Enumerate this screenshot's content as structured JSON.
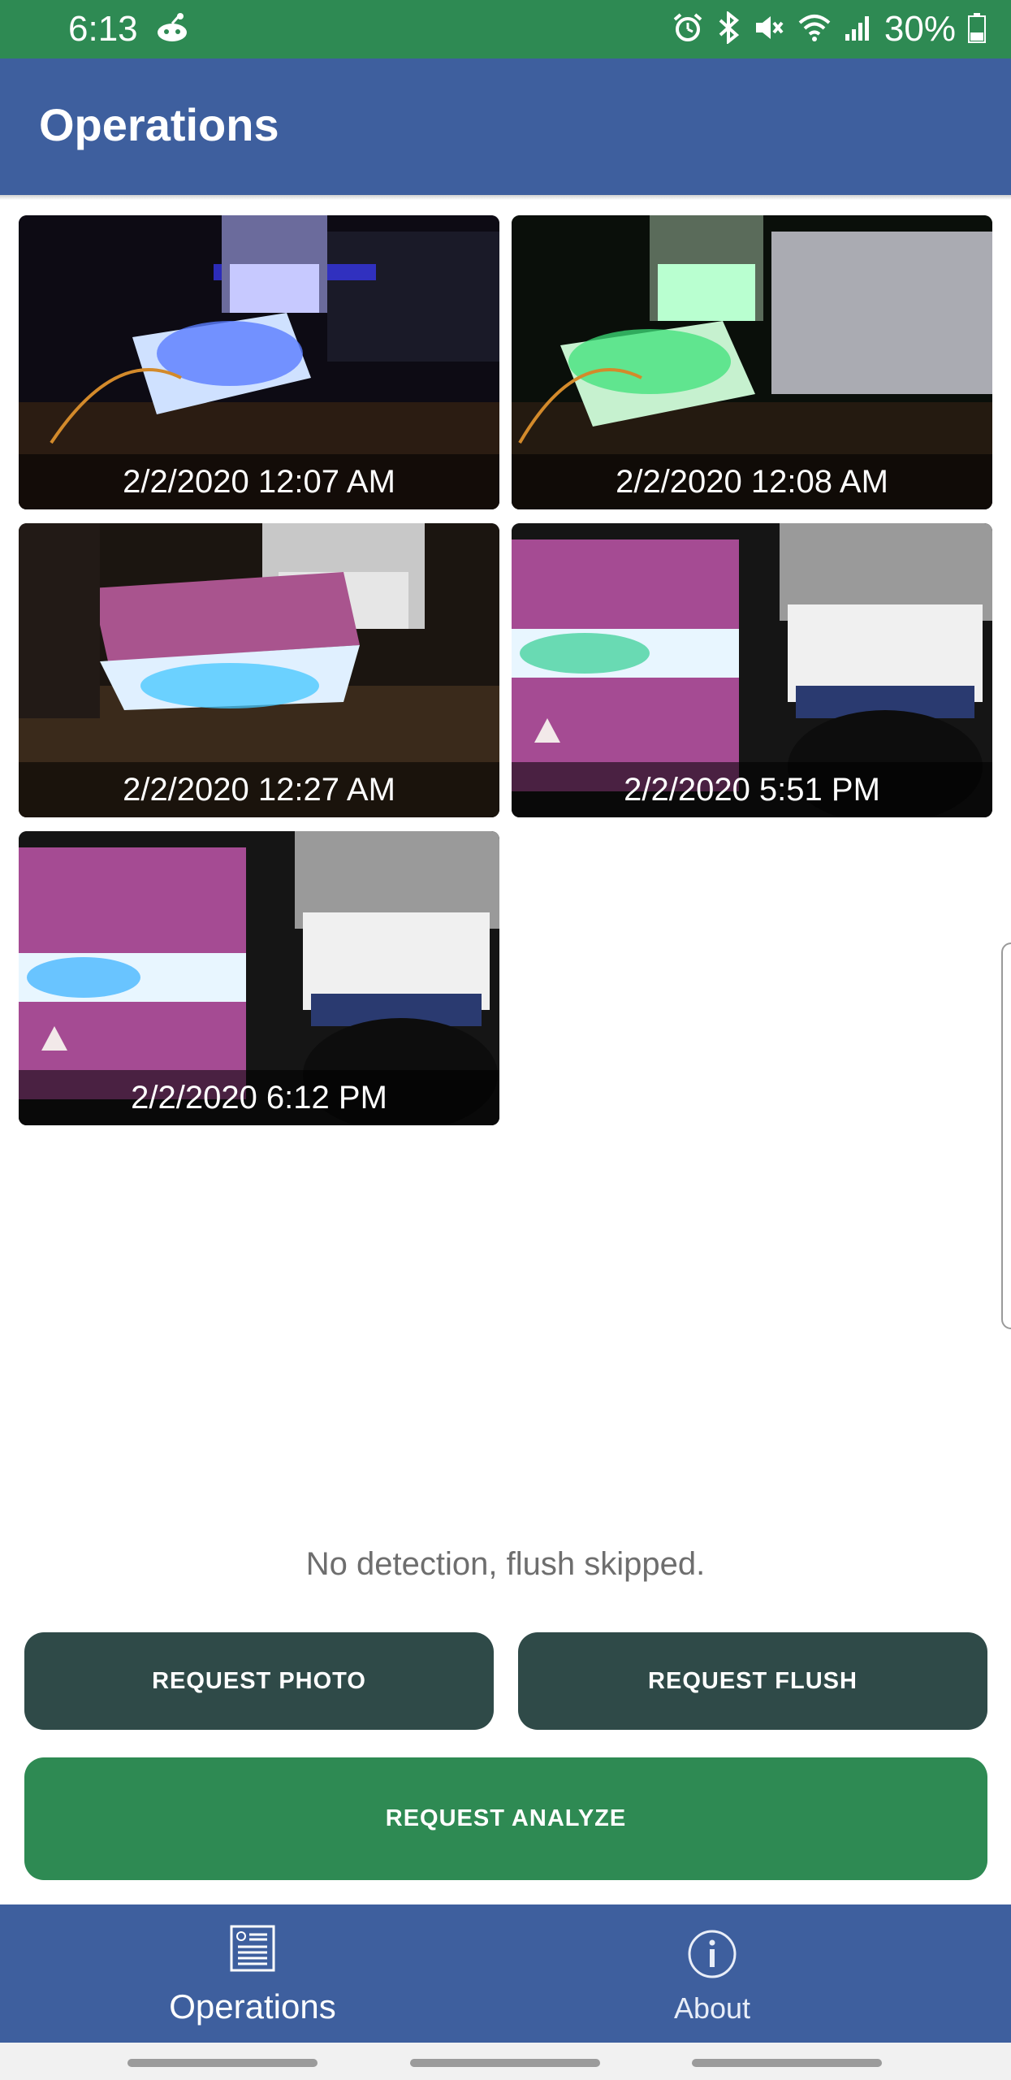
{
  "status_bar": {
    "time": "6:13",
    "battery": "30%",
    "icons": [
      "reddit-icon",
      "alarm-icon",
      "bluetooth-icon",
      "mute-icon",
      "wifi-icon",
      "signal-icon",
      "battery-icon"
    ]
  },
  "app_bar": {
    "title": "Operations"
  },
  "photos": [
    {
      "timestamp": "2/2/2020 12:07 AM",
      "lighting": "blue"
    },
    {
      "timestamp": "2/2/2020 12:08 AM",
      "lighting": "green"
    },
    {
      "timestamp": "2/2/2020 12:27 AM",
      "lighting": "cyan"
    },
    {
      "timestamp": "2/2/2020 5:51 PM",
      "lighting": "cyan"
    },
    {
      "timestamp": "2/2/2020 6:12 PM",
      "lighting": "cyan"
    }
  ],
  "status_message": "No detection, flush skipped.",
  "buttons": {
    "request_photo": "REQUEST PHOTO",
    "request_flush": "REQUEST FLUSH",
    "request_analyze": "REQUEST ANALYZE"
  },
  "bottom_nav": {
    "operations": "Operations",
    "about": "About"
  },
  "colors": {
    "status_bar": "#2e8a53",
    "app_bar": "#3e5f9e",
    "dark_button": "#2f4a48",
    "accent_button": "#2e8a53"
  }
}
